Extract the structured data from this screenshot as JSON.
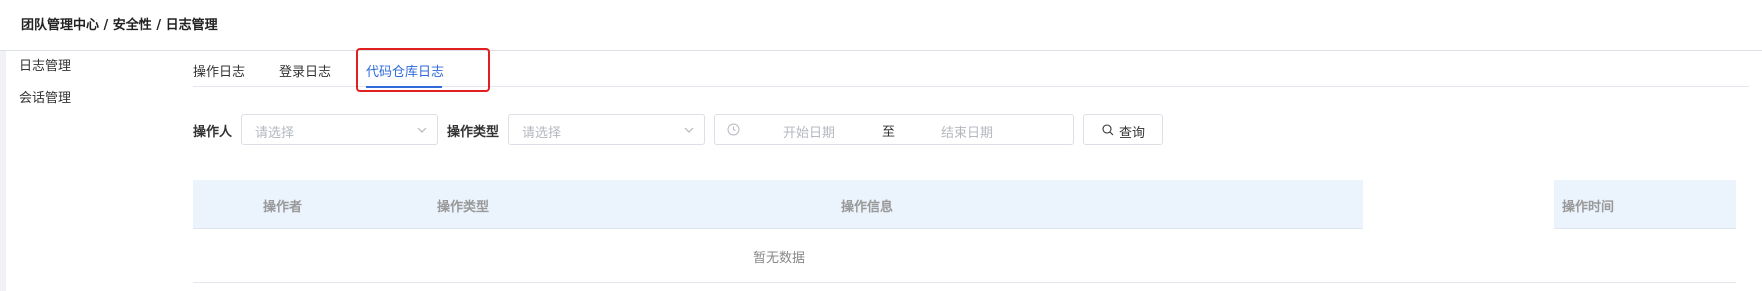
{
  "breadcrumb": "团队管理中心 / 安全性 / 日志管理",
  "sidebar": {
    "items": [
      {
        "label": "日志管理"
      },
      {
        "label": "会话管理"
      }
    ]
  },
  "tabs": [
    {
      "label": "操作日志",
      "active": false
    },
    {
      "label": "登录日志",
      "active": false
    },
    {
      "label": "代码仓库日志",
      "active": true
    }
  ],
  "filters": {
    "operator_label": "操作人",
    "operator_placeholder": "请选择",
    "type_label": "操作类型",
    "type_placeholder": "请选择",
    "start_placeholder": "开始日期",
    "range_separator": "至",
    "end_placeholder": "结束日期",
    "query_label": "查询"
  },
  "table": {
    "columns": [
      "操作者",
      "操作类型",
      "操作信息",
      "操作时间"
    ],
    "empty_text": "暂无数据"
  },
  "colors": {
    "accent": "#2f6ad8",
    "highlight_border": "#e02020",
    "header_bg": "#ebf3fd"
  }
}
